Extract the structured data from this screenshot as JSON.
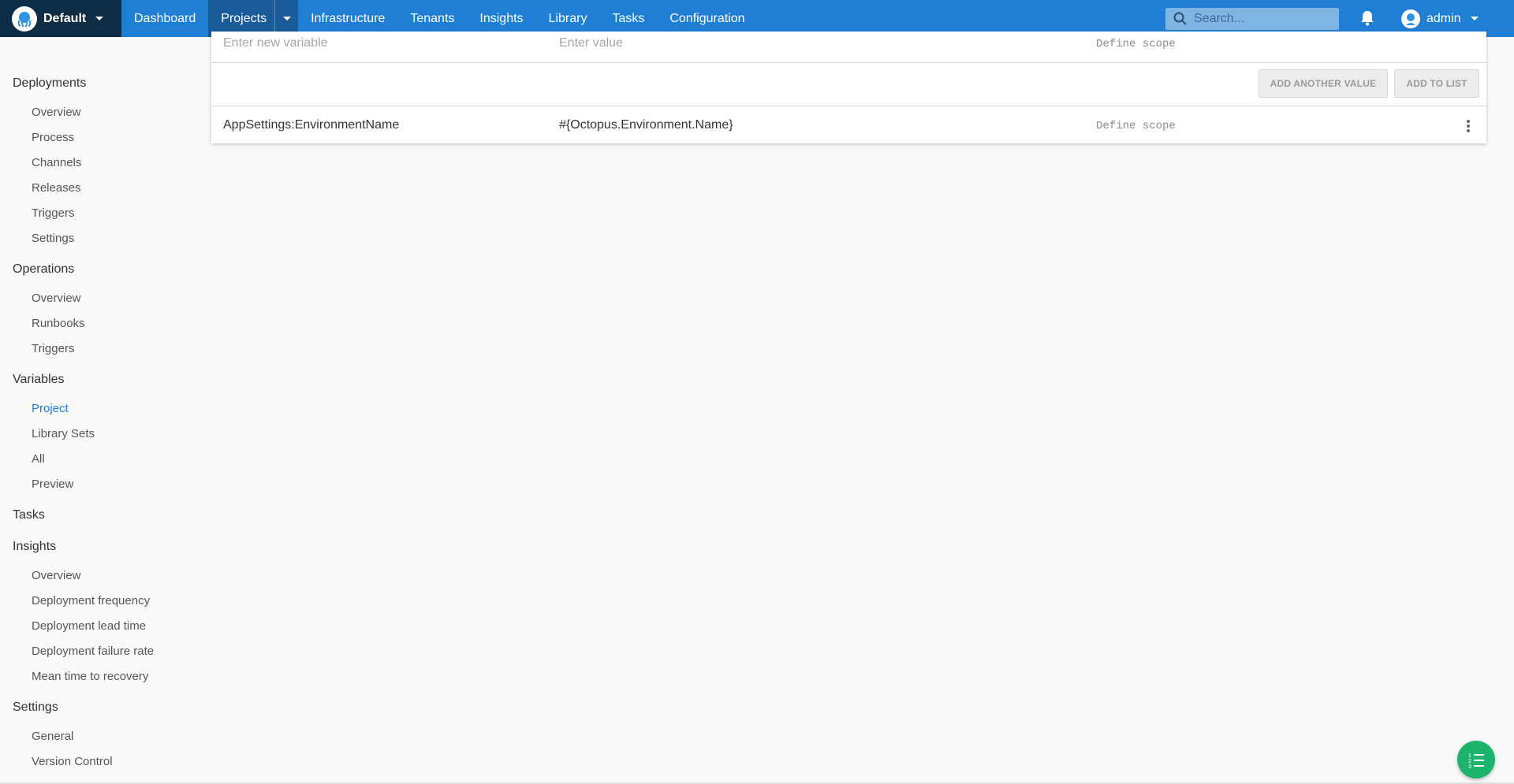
{
  "topbar": {
    "space_name": "Default",
    "nav": [
      "Dashboard",
      "Projects",
      "Infrastructure",
      "Tenants",
      "Insights",
      "Library",
      "Tasks",
      "Configuration"
    ],
    "active_nav": "Projects",
    "search_placeholder": "Search...",
    "user_name": "admin",
    "colors": {
      "bar": "#1f7fd4",
      "space_bg": "#0e2d45",
      "active": "#1a5c99"
    }
  },
  "sidebar": {
    "deployments": {
      "title": "Deployments",
      "items": [
        "Overview",
        "Process",
        "Channels",
        "Releases",
        "Triggers",
        "Settings"
      ]
    },
    "operations": {
      "title": "Operations",
      "items": [
        "Overview",
        "Runbooks",
        "Triggers"
      ]
    },
    "variables": {
      "title": "Variables",
      "items": [
        "Project",
        "Library Sets",
        "All",
        "Preview"
      ],
      "active": "Project"
    },
    "tasks": {
      "title": "Tasks"
    },
    "insights": {
      "title": "Insights",
      "items": [
        "Overview",
        "Deployment frequency",
        "Deployment lead time",
        "Deployment failure rate",
        "Mean time to recovery"
      ]
    },
    "settings": {
      "title": "Settings",
      "items": [
        "General",
        "Version Control"
      ]
    }
  },
  "editor": {
    "name_placeholder": "Enter new variable",
    "value_placeholder": "Enter value",
    "scope_placeholder": "Define scope",
    "add_another_label": "ADD ANOTHER VALUE",
    "add_to_list_label": "ADD TO LIST"
  },
  "variables": [
    {
      "name": "AppSettings:EnvironmentName",
      "value": "#{Octopus.Environment.Name}",
      "scope": "Define scope"
    }
  ],
  "fab": {
    "icon": "list-numbered-icon",
    "color": "#1cb46b"
  }
}
